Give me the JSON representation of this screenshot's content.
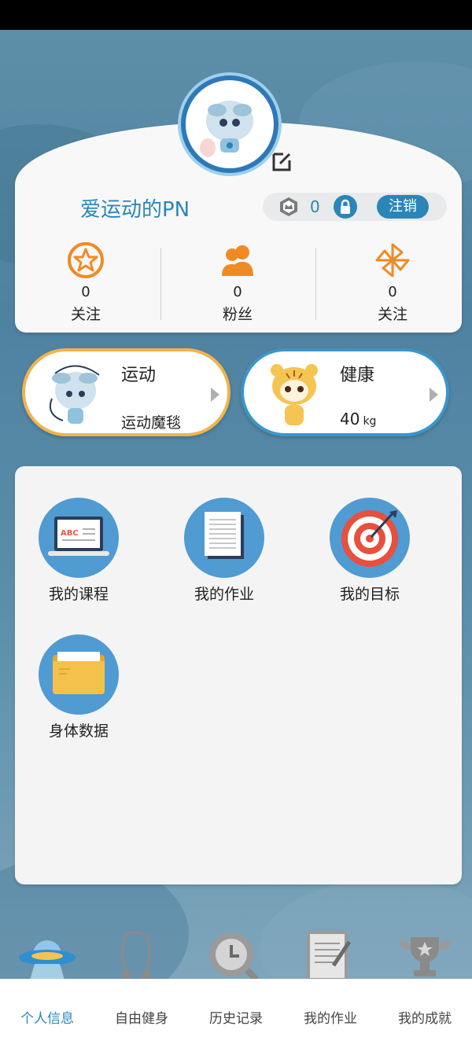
{
  "profile": {
    "username": "爱运动的PN",
    "medal_count": "0",
    "logout_label": "注销"
  },
  "stats": [
    {
      "value": "0",
      "label": "关注",
      "icon": "star-circle-icon"
    },
    {
      "value": "0",
      "label": "粉丝",
      "icon": "people-icon"
    },
    {
      "value": "0",
      "label": "关注",
      "icon": "pinwheel-icon"
    }
  ],
  "cards": {
    "sport": {
      "title": "运动",
      "subtitle": "运动魔毯"
    },
    "health": {
      "title": "健康",
      "weight": "40",
      "unit": "kg"
    }
  },
  "menu": [
    {
      "label": "我的课程",
      "icon": "laptop-abc-icon"
    },
    {
      "label": "我的作业",
      "icon": "document-icon"
    },
    {
      "label": "我的目标",
      "icon": "target-icon"
    },
    {
      "label": "身体数据",
      "icon": "folder-icon"
    }
  ],
  "nav": [
    {
      "label": "个人信息",
      "icon": "ufo-icon",
      "active": true
    },
    {
      "label": "自由健身",
      "icon": "jump-rope-icon",
      "active": false
    },
    {
      "label": "历史记录",
      "icon": "history-icon",
      "active": false
    },
    {
      "label": "我的作业",
      "icon": "notebook-icon",
      "active": false
    },
    {
      "label": "我的成就",
      "icon": "trophy-icon",
      "active": false
    }
  ],
  "colors": {
    "accent": "#2a86b8",
    "sport_border": "#f1b34f",
    "health_border": "#3d95c8",
    "menu_circle": "#4f9bd2",
    "icon_orange": "#f08a24"
  }
}
